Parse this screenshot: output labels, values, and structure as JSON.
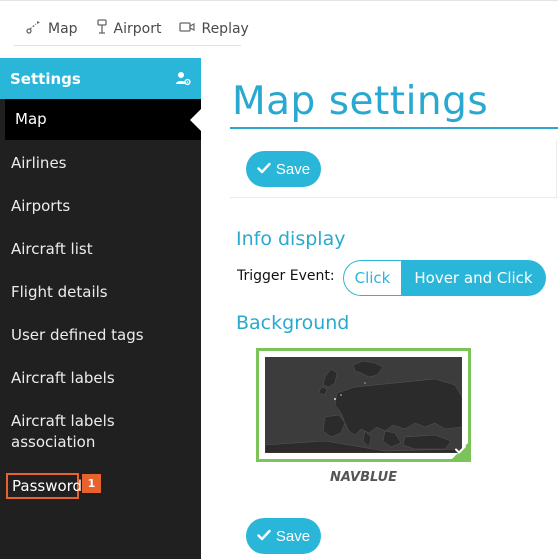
{
  "topnav": {
    "items": [
      {
        "label": "Map",
        "icon": "map-route-icon"
      },
      {
        "label": "Airport",
        "icon": "airport-icon"
      },
      {
        "label": "Replay",
        "icon": "replay-camera-icon"
      }
    ]
  },
  "sidebar": {
    "header": "Settings",
    "header_icon": "user-settings-icon",
    "items": [
      {
        "label": "Map"
      },
      {
        "label": "Airlines"
      },
      {
        "label": "Airports"
      },
      {
        "label": "Aircraft list"
      },
      {
        "label": "Flight details"
      },
      {
        "label": "User defined tags"
      },
      {
        "label": "Aircraft labels"
      },
      {
        "label": "Aircraft labels association"
      },
      {
        "label": "Password"
      }
    ],
    "badge": "1"
  },
  "main": {
    "title": "Map settings",
    "save_label": "Save",
    "info_display": {
      "heading": "Info display",
      "trigger_label": "Trigger Event:",
      "options": [
        "Click",
        "Hover and Click"
      ],
      "selected": "Hover and Click"
    },
    "background": {
      "heading": "Background",
      "selected_map": "NAVBLUE"
    }
  },
  "colors": {
    "accent": "#29b6d9",
    "sidebar_bg": "#202020",
    "highlight": "#e8622d",
    "selected_border": "#7cc35a"
  }
}
